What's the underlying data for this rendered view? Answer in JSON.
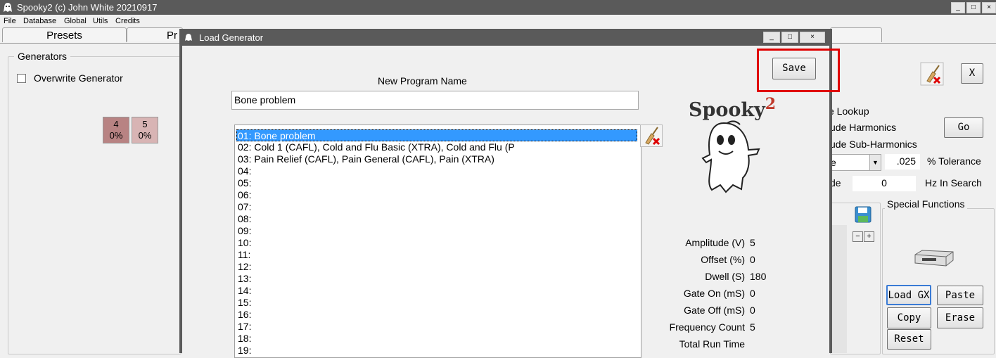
{
  "app": {
    "title": "Spooky2 (c) John White 20210917",
    "window_buttons": [
      "_",
      "□",
      "×"
    ]
  },
  "menu": [
    "File",
    "Database",
    "Global",
    "Utils",
    "Credits"
  ],
  "tabs": [
    "Presets",
    "Pr"
  ],
  "generators": {
    "title": "Generators",
    "overwrite_label": "Overwrite Generator",
    "items": [
      {
        "number": "4",
        "percent": "0%"
      },
      {
        "number": "5",
        "percent": "0%"
      }
    ]
  },
  "lookup": {
    "title_fragment": "e Lookup",
    "harmonics_label": "ude Harmonics",
    "subharmonics_label": "ude Sub-Harmonics",
    "go_label": "Go",
    "select_value": "e",
    "tolerance_value": ".025",
    "tolerance_label": "% Tolerance",
    "hz_prefix": "de",
    "hz_value": "0",
    "hz_label": "Hz In Search",
    "close_label": "X"
  },
  "special_functions": {
    "title": "Special Functions",
    "buttons": {
      "load_gx": "Load GX",
      "paste": "Paste",
      "copy": "Copy",
      "erase": "Erase",
      "reset": "Reset"
    },
    "stepper": {
      "minus": "−",
      "plus": "+"
    }
  },
  "dialog": {
    "title": "Load Generator",
    "save_label": "Save",
    "new_program_label": "New Program Name",
    "program_name_value": "Bone problem",
    "logo_text": "Spooky",
    "logo_superscript": "2",
    "programs": [
      "01: Bone problem",
      "02: Cold 1 (CAFL), Cold and Flu Basic (XTRA), Cold and Flu (P",
      "03: Pain Relief (CAFL), Pain General (CAFL), Pain (XTRA)",
      "04:",
      "05:",
      "06:",
      "07:",
      "08:",
      "09:",
      "10:",
      "11:",
      "12:",
      "13:",
      "14:",
      "15:",
      "16:",
      "17:",
      "18:",
      "19:"
    ],
    "settings": [
      {
        "label": "Amplitude (V)",
        "value": "5"
      },
      {
        "label": "Offset (%)",
        "value": "0"
      },
      {
        "label": "Dwell (S)",
        "value": "180"
      },
      {
        "label": "Gate On (mS)",
        "value": "0"
      },
      {
        "label": "Gate Off (mS)",
        "value": "0"
      },
      {
        "label": "Frequency Count",
        "value": "5"
      },
      {
        "label": "Total Run Time",
        "value": ""
      }
    ]
  },
  "colors": {
    "selection": "#3399ff",
    "highlight_box": "#e00000",
    "titlebar": "#5a5a5a",
    "gen4_bg": "#b88383",
    "gen5_bg": "#d8b4b4"
  }
}
